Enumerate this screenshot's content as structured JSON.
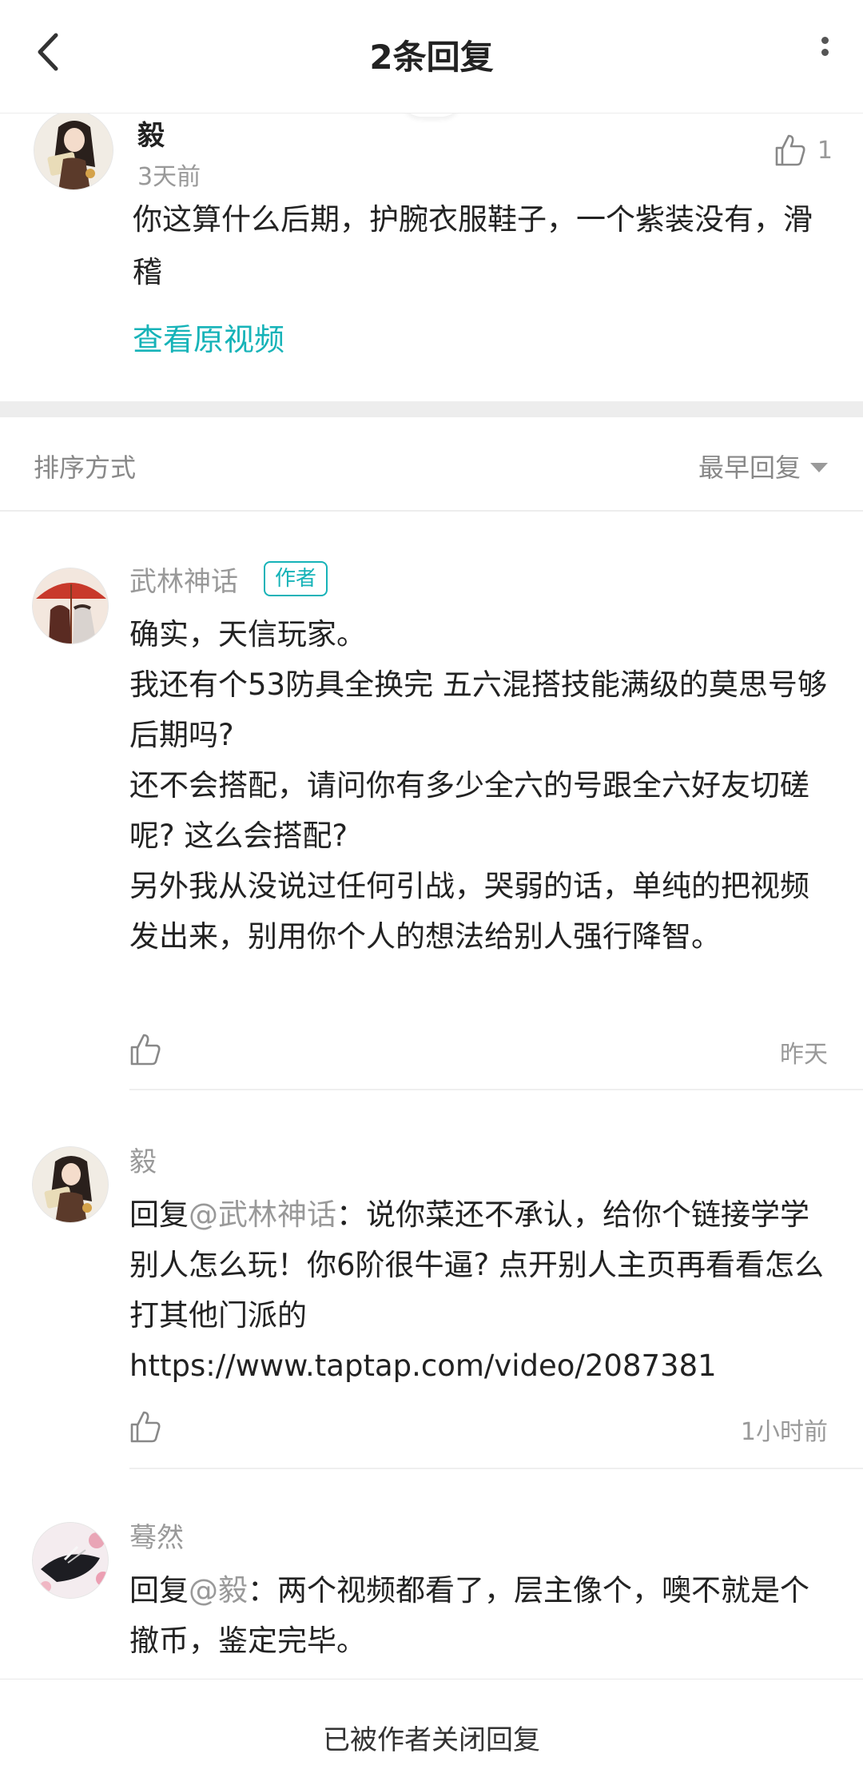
{
  "header": {
    "title": "2条回复"
  },
  "main_comment": {
    "author": "毅",
    "time": "3天前",
    "like_count": "1",
    "text": "你这算什么后期，护腕衣服鞋子，一个紫装没有，滑稽",
    "link_label": "查看原视频"
  },
  "sort": {
    "label": "排序方式",
    "value": "最早回复"
  },
  "replies": [
    {
      "author": "武林神话",
      "author_tag": "作者",
      "paragraphs": [
        "确实，天信玩家。",
        "我还有个53防具全换完 五六混搭技能满级的莫思号够后期吗?",
        "还不会搭配，请问你有多少全六的号跟全六好友切磋呢? 这么会搭配?",
        "另外我从没说过任何引战，哭弱的话，单纯的把视频发出来，别用你个人的想法给别人强行降智。"
      ],
      "time": "昨天"
    },
    {
      "author": "毅",
      "reply_prefix": "回复",
      "mention": "@武林神话",
      "text": "：说你菜还不承认，给你个链接学学别人怎么玩！你6阶很牛逼? 点开别人主页再看看怎么打其他门派的",
      "url": "https://www.taptap.com/video/2087381",
      "time": "1小时前"
    },
    {
      "author": "蓦然",
      "reply_prefix": "回复",
      "mention": "@毅",
      "text": "：两个视频都看了，层主像个，噢不就是个撤币，鉴定完毕。"
    }
  ],
  "footer": {
    "closed_text": "已被作者关闭回复"
  },
  "colors": {
    "accent": "#16b3b8",
    "muted": "#999999",
    "text": "#222222",
    "separator": "#ededed"
  }
}
